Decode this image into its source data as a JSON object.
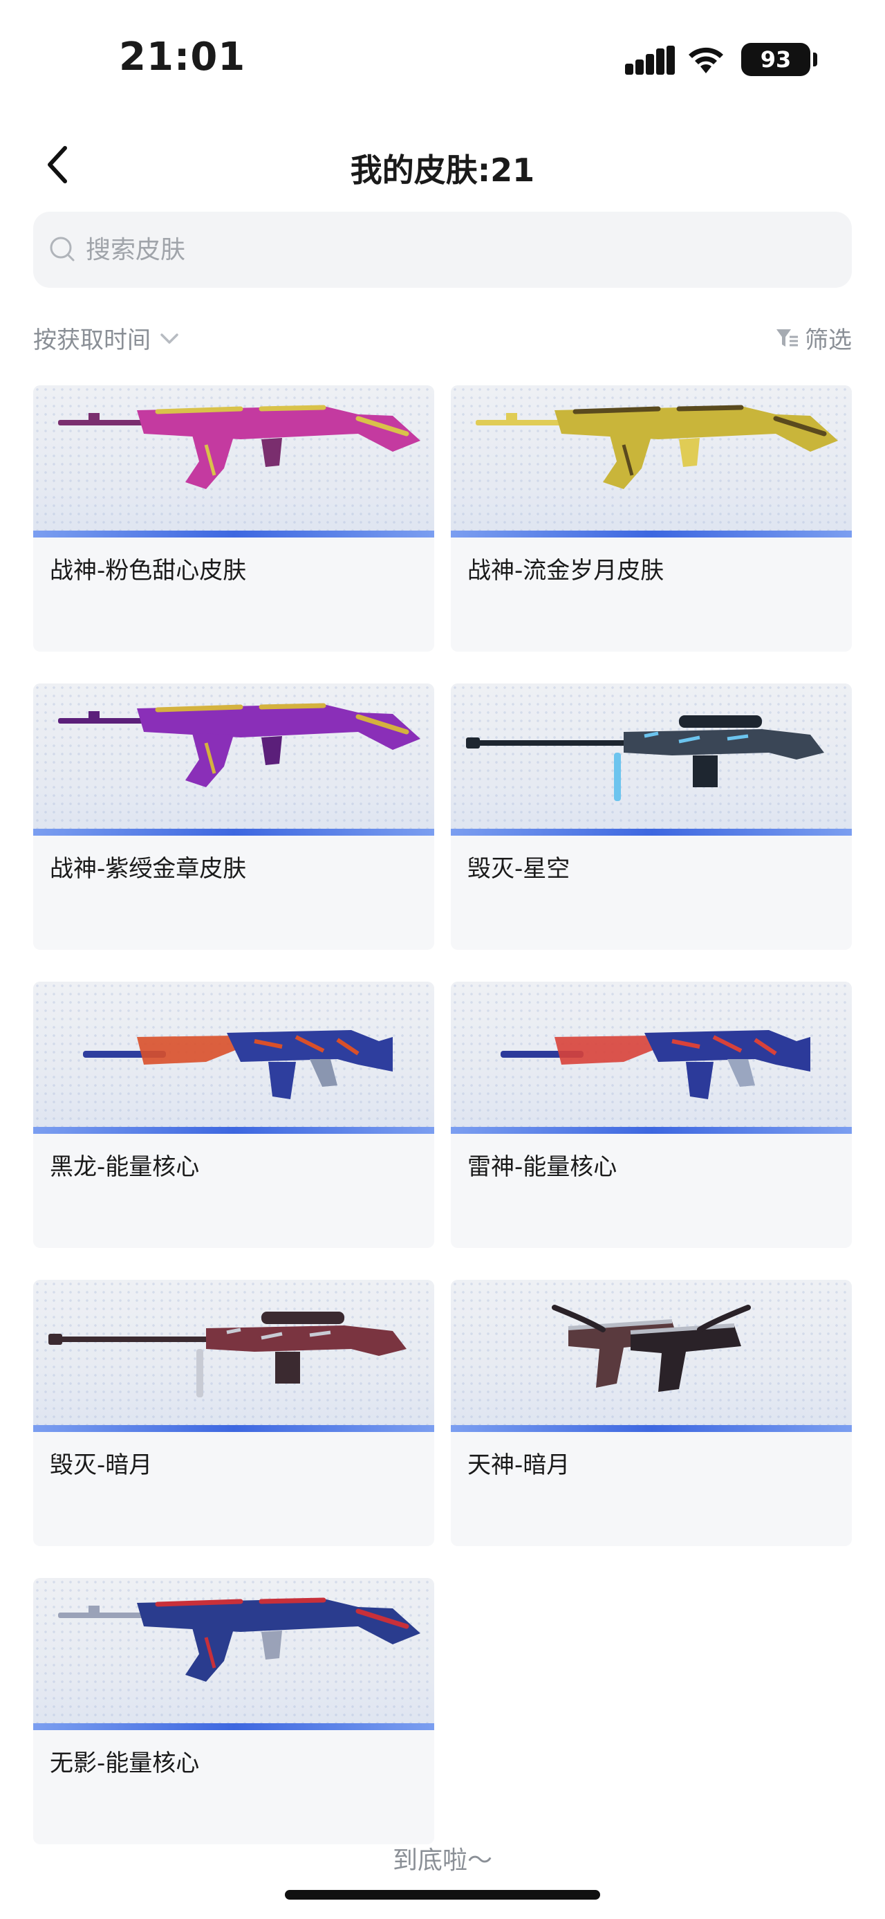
{
  "status_bar": {
    "time": "21:01",
    "battery": "93"
  },
  "nav": {
    "title": "我的皮肤:21"
  },
  "search": {
    "placeholder": "搜索皮肤"
  },
  "sort": {
    "label": "按获取时间"
  },
  "filter": {
    "label": "筛选"
  },
  "colors": {
    "accent": "#3d67e0",
    "card_bg": "#f6f7f9",
    "muted_text": "#8a8f96"
  },
  "skins": [
    {
      "name": "战神-粉色甜心皮肤",
      "weapon": "rifle",
      "palette": [
        "#c43aa0",
        "#d9c24a",
        "#7a2e6e"
      ]
    },
    {
      "name": "战神-流金岁月皮肤",
      "weapon": "rifle",
      "palette": [
        "#c9b53a",
        "#5a4a1e",
        "#e0cc55"
      ]
    },
    {
      "name": "战神-紫绶金章皮肤",
      "weapon": "rifle",
      "palette": [
        "#8a2fb8",
        "#d4b23e",
        "#5b1f7a"
      ]
    },
    {
      "name": "毁灭-星空",
      "weapon": "sniper",
      "palette": [
        "#3a4656",
        "#6cc4ee",
        "#1e2630"
      ]
    },
    {
      "name": "黑龙-能量核心",
      "weapon": "carbine",
      "palette": [
        "#2e3e9e",
        "#d9502a",
        "#8a96b0"
      ]
    },
    {
      "name": "雷神-能量核心",
      "weapon": "carbine",
      "palette": [
        "#2c3a9a",
        "#d8423a",
        "#9aa6c0"
      ]
    },
    {
      "name": "毁灭-暗月",
      "weapon": "sniper",
      "palette": [
        "#7a3440",
        "#c8cbd4",
        "#3b2a30"
      ]
    },
    {
      "name": "天神-暗月",
      "weapon": "pistols",
      "palette": [
        "#5a3a3e",
        "#b8bcc6",
        "#2a2228"
      ]
    },
    {
      "name": "无影-能量核心",
      "weapon": "rifle",
      "palette": [
        "#2a3c8e",
        "#c8303a",
        "#9aa2b8"
      ]
    }
  ],
  "footer": {
    "text": "到底啦～"
  }
}
